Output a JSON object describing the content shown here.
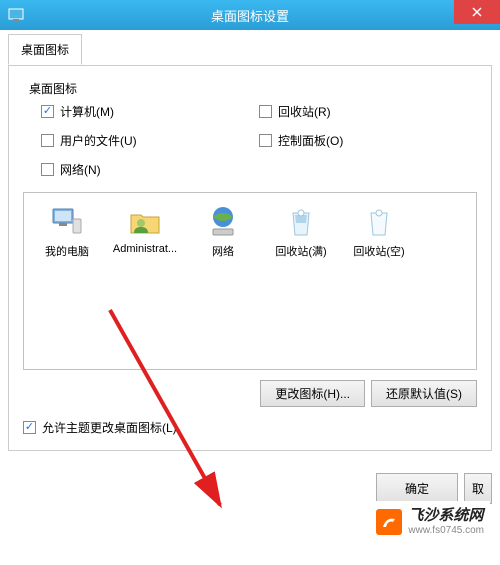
{
  "titlebar": {
    "title": "桌面图标设置"
  },
  "tab": {
    "label": "桌面图标"
  },
  "group": {
    "label": "桌面图标"
  },
  "checkboxes": {
    "computer": {
      "label": "计算机(M)",
      "checked": true
    },
    "recycle": {
      "label": "回收站(R)",
      "checked": false
    },
    "userfiles": {
      "label": "用户的文件(U)",
      "checked": false
    },
    "controlpanel": {
      "label": "控制面板(O)",
      "checked": false
    },
    "network": {
      "label": "网络(N)",
      "checked": false
    }
  },
  "icons": {
    "mycomputer": "我的电脑",
    "admin": "Administrat...",
    "network": "网络",
    "recycle_full": "回收站(满)",
    "recycle_empty": "回收站(空)"
  },
  "buttons": {
    "change_icon": "更改图标(H)...",
    "restore_default": "还原默认值(S)",
    "ok": "确定",
    "cancel": "取"
  },
  "allow_themes": {
    "label": "允许主题更改桌面图标(L)",
    "checked": true
  },
  "watermark": {
    "title": "飞沙系统网",
    "url": "www.fs0745.com"
  }
}
